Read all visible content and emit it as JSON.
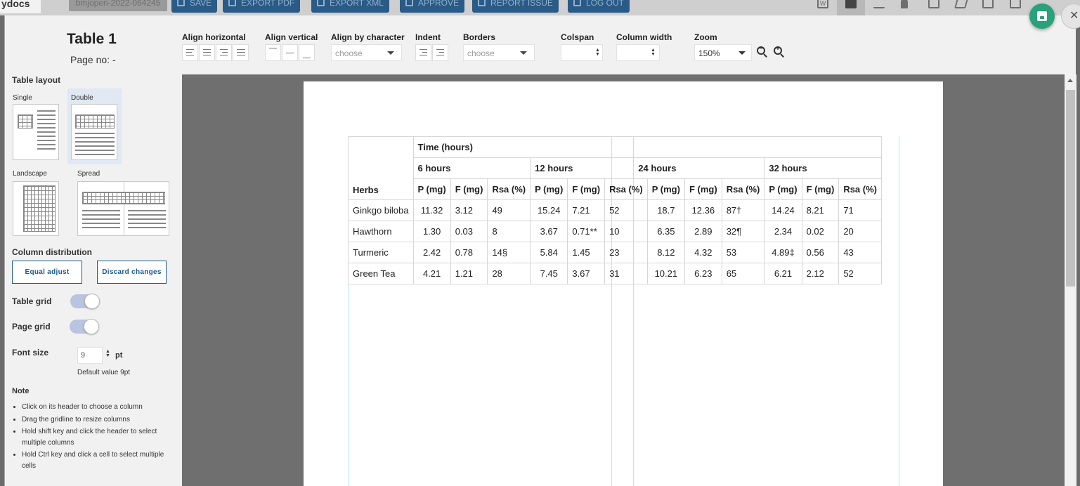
{
  "app": {
    "logo": "ydocs",
    "doc_id": "bmjopen-2022-064245",
    "top_buttons": [
      "SAVE",
      "EXPORT PDF",
      "EXPORT XML",
      "APPROVE",
      "REPORT ISSUE",
      "LOG OUT"
    ],
    "word_icon": "W"
  },
  "panel": {
    "title": "Table 1",
    "page_no": "Page no: -",
    "table_layout_label": "Table layout",
    "layouts": [
      "Single",
      "Double",
      "Landscape",
      "Spread"
    ],
    "selected_layout": "Double",
    "column_distribution_label": "Column distribution",
    "equal_adjust": "Equal adjust",
    "discard_changes": "Discard changes",
    "table_grid_label": "Table grid",
    "page_grid_label": "Page grid",
    "font_size_label": "Font size",
    "font_size_value": "9",
    "font_size_unit": "pt",
    "font_size_default": "Default value 9pt",
    "note_label": "Note",
    "notes": [
      "Click on its header to choose a column",
      "Drag the gridline to resize columns",
      "Hold shift key and click the header to select multiple columns",
      "Hold Ctrl key and click a cell to select multiple cells"
    ]
  },
  "toolbar": {
    "align_horizontal": "Align horizontal",
    "align_vertical": "Align vertical",
    "align_by_character": "Align by character",
    "align_char_placeholder": "choose",
    "indent": "Indent",
    "borders": "Borders",
    "borders_placeholder": "choose",
    "colspan": "Colspan",
    "column_width": "Column width",
    "zoom": "Zoom",
    "zoom_value": "150%"
  },
  "table": {
    "group_header": "Time (hours)",
    "time_groups": [
      "6 hours",
      "12 hours",
      "24 hours",
      "32 hours"
    ],
    "row_header": "Herbs",
    "sub_headers": [
      "P (mg)",
      "F (mg)",
      "Rsa (%)"
    ],
    "rows": [
      {
        "herb": "Ginkgo biloba",
        "values": [
          "11.32",
          "3.12",
          "49",
          "15.24",
          "7.21",
          "52",
          "18.7",
          "12.36",
          "87†",
          "14.24",
          "8.21",
          "71"
        ]
      },
      {
        "herb": "Hawthorn",
        "values": [
          "1.30",
          "0.03",
          "8",
          "3.67",
          "0.71**",
          "10",
          "6.35",
          "2.89",
          "32¶",
          "2.34",
          "0.02",
          "20"
        ]
      },
      {
        "herb": "Turmeric",
        "values": [
          "2.42",
          "0.78",
          "14§",
          "5.84",
          "1.45",
          "23",
          "8.12",
          "4.32",
          "53",
          "4.89‡",
          "0.56",
          "43"
        ]
      },
      {
        "herb": "Green Tea",
        "values": [
          "4.21",
          "1.21",
          "28",
          "7.45",
          "3.67",
          "31",
          "10.21",
          "6.23",
          "65",
          "6.21",
          "2.12",
          "52"
        ]
      }
    ]
  }
}
